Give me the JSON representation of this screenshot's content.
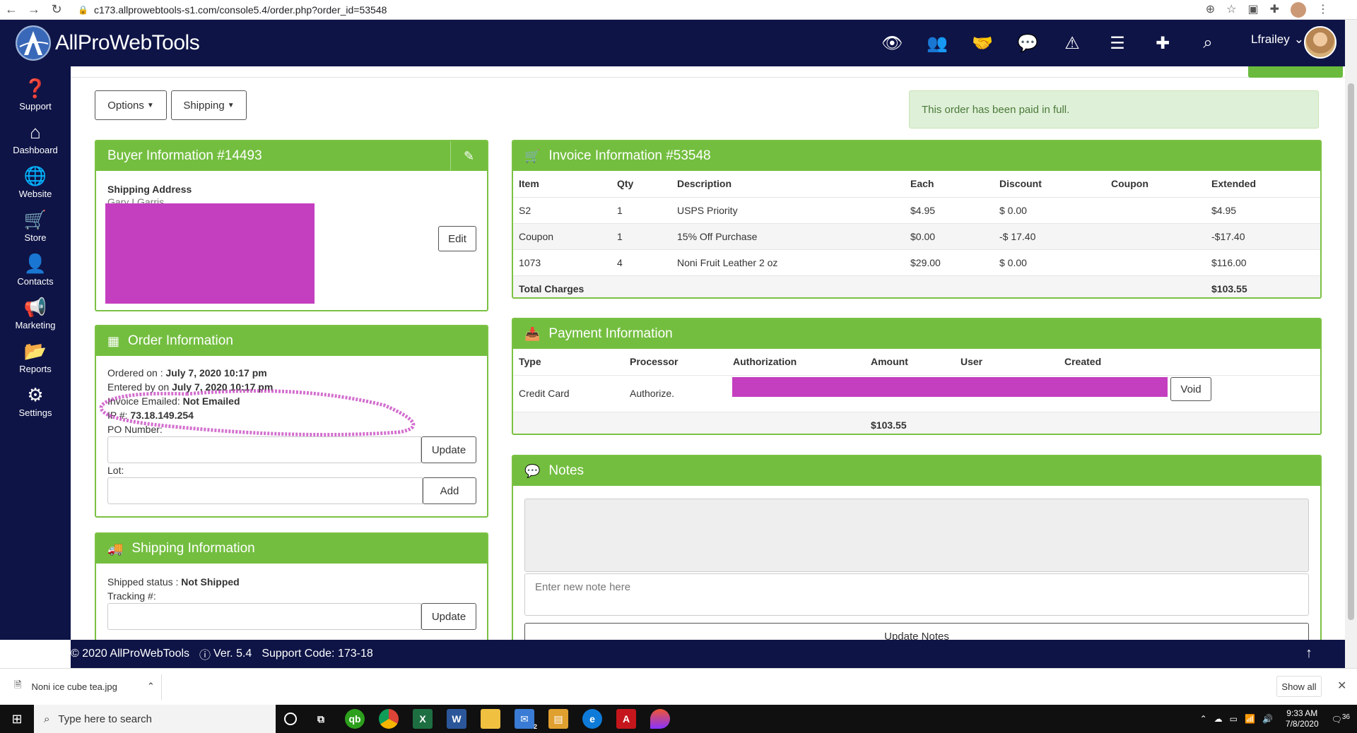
{
  "browser": {
    "url": "c173.allprowebtools-s1.com/console5.4/order.php?order_id=53548"
  },
  "app": {
    "brand": "AllProWebTools",
    "user": "Lfrailey"
  },
  "sidebar": {
    "items": [
      {
        "label": "Support",
        "icon": "question-circle-icon"
      },
      {
        "label": "Dashboard",
        "icon": "home-icon"
      },
      {
        "label": "Website",
        "icon": "globe-icon"
      },
      {
        "label": "Store",
        "icon": "cart-icon"
      },
      {
        "label": "Contacts",
        "icon": "user-icon"
      },
      {
        "label": "Marketing",
        "icon": "megaphone-icon"
      },
      {
        "label": "Reports",
        "icon": "folder-icon"
      },
      {
        "label": "Settings",
        "icon": "gear-icon"
      }
    ]
  },
  "toolbar": {
    "options_label": "Options",
    "shipping_label": "Shipping"
  },
  "alert": {
    "paid_text": "This order has been paid in full."
  },
  "buyer": {
    "title": "Buyer Information #14493",
    "shipping_address_label": "Shipping Address",
    "name_partial": "Gary I Garris",
    "edit_label": "Edit"
  },
  "order": {
    "title": "Order Information",
    "ordered_on_label": "Ordered on : ",
    "ordered_on_value": "July 7, 2020 10:17 pm",
    "entered_by_label": "Entered by on ",
    "entered_by_value": "July 7, 2020 10:17 pm",
    "invoice_emailed_label": "Invoice Emailed: ",
    "invoice_emailed_value": "Not Emailed",
    "ip_label": "IP #: ",
    "ip_value": "73.18.149.254",
    "po_label": "PO Number:",
    "update_label": "Update",
    "lot_label": "Lot:",
    "add_label": "Add"
  },
  "shipping": {
    "title": "Shipping Information",
    "status_label": "Shipped status : ",
    "status_value": "Not Shipped",
    "tracking_label": "Tracking #:",
    "update_label": "Update"
  },
  "invoice": {
    "title": "Invoice Information #53548",
    "columns": [
      "Item",
      "Qty",
      "Description",
      "Each",
      "Discount",
      "Coupon",
      "Extended"
    ],
    "rows": [
      {
        "item": "S2",
        "qty": "1",
        "desc": "USPS Priority",
        "each": "$4.95",
        "discount": "$ 0.00",
        "coupon": "",
        "extended": "$4.95"
      },
      {
        "item": "Coupon",
        "qty": "1",
        "desc": "15% Off Purchase",
        "each": "$0.00",
        "discount": "-$ 17.40",
        "coupon": "",
        "extended": "-$17.40"
      },
      {
        "item": "1073",
        "qty": "4",
        "desc": "Noni Fruit Leather 2 oz",
        "each": "$29.00",
        "discount": "$ 0.00",
        "coupon": "",
        "extended": "$116.00"
      }
    ],
    "total_label": "Total Charges",
    "total_value": "$103.55"
  },
  "payment": {
    "title": "Payment Information",
    "columns": [
      "Type",
      "Processor",
      "Authorization",
      "Amount",
      "User",
      "Created"
    ],
    "row": {
      "type": "Credit Card",
      "processor": "Authorize."
    },
    "void_label": "Void",
    "total_value": "$103.55"
  },
  "notes": {
    "title": "Notes",
    "placeholder": "Enter new note here",
    "update_label": "Update Notes"
  },
  "footer": {
    "copyright": "© 2020 AllProWebTools",
    "version": "Ver. 5.4",
    "support_code": "Support Code: 173-18"
  },
  "downloads": {
    "file": "Noni ice cube tea.jpg",
    "show_all": "Show all"
  },
  "taskbar": {
    "search_placeholder": "Type here to search",
    "time": "9:33 AM",
    "date": "7/8/2020",
    "mail_badge": "2",
    "notif_count": "36"
  }
}
